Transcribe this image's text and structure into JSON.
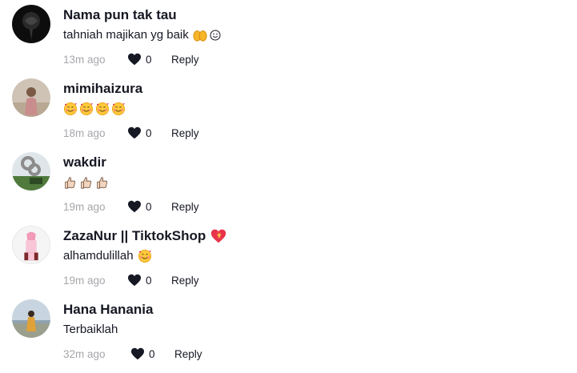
{
  "comments": [
    {
      "username": "Nama pun tak tau",
      "text": "tahniah majikan yg baik",
      "time": "13m ago",
      "likes": "0",
      "reply": "Reply",
      "avatar_color": "#111111",
      "emojis": [
        "open-hands-emoji",
        "smile-emoji"
      ]
    },
    {
      "username": "mimihaizura",
      "text": "",
      "time": "18m ago",
      "likes": "0",
      "reply": "Reply",
      "avatar_color": "#c9b9a8",
      "emojis": [
        "smiling-face-with-hearts-emoji",
        "smiling-face-with-hearts-emoji",
        "smiling-face-with-hearts-emoji",
        "smiling-face-with-hearts-emoji"
      ]
    },
    {
      "username": "wakdir",
      "text": "",
      "time": "19m ago",
      "likes": "0",
      "reply": "Reply",
      "avatar_color": "#5e7f4d",
      "emojis": [
        "thumbs-up-emoji",
        "thumbs-up-emoji",
        "thumbs-up-emoji"
      ]
    },
    {
      "username": "ZazaNur || TiktokShop",
      "text": "alhamdulillah",
      "time": "19m ago",
      "likes": "0",
      "reply": "Reply",
      "avatar_color": "#f2f2f2",
      "emojis": [
        "smiling-face-with-hearts-emoji"
      ],
      "badge": "sparkling-heart-emoji"
    },
    {
      "username": "Hana Hanania",
      "text": "Terbaiklah",
      "time": "32m ago",
      "likes": "0",
      "reply": "Reply",
      "avatar_color": "#a9b9c9",
      "emojis": []
    }
  ],
  "colors": {
    "primary_text": "#161823",
    "secondary_text": "#a6a7ab",
    "heart": "#161823"
  }
}
